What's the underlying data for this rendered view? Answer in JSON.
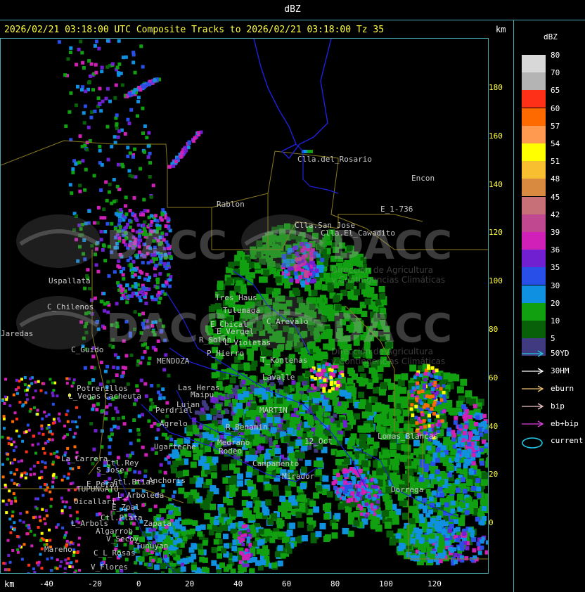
{
  "title": "dBZ",
  "header": "2026/02/21 03:18:00 UTC Composite Tracks to 2026/02/21 03:18:00 Tz 35",
  "units_top": "km",
  "units_bottom": "km",
  "y_ticks": [
    "180",
    "160",
    "140",
    "120",
    "100",
    "80",
    "60",
    "40",
    "20",
    "0"
  ],
  "x_ticks": [
    "-40",
    "-20",
    "0",
    "20",
    "40",
    "60",
    "80",
    "100",
    "120"
  ],
  "legend": {
    "title": "dBZ",
    "scale": [
      {
        "label": "80",
        "color": "#d8d8d8"
      },
      {
        "label": "70",
        "color": "#b4b4b4"
      },
      {
        "label": "65",
        "color": "#ff3018"
      },
      {
        "label": "60",
        "color": "#ff6a00"
      },
      {
        "label": "57",
        "color": "#ff9a50"
      },
      {
        "label": "54",
        "color": "#ffff00"
      },
      {
        "label": "51",
        "color": "#f8c030"
      },
      {
        "label": "48",
        "color": "#d88a40"
      },
      {
        "label": "45",
        "color": "#c87078"
      },
      {
        "label": "42",
        "color": "#c04890"
      },
      {
        "label": "39",
        "color": "#d020b8"
      },
      {
        "label": "36",
        "color": "#7020d0"
      },
      {
        "label": "35",
        "color": "#2850e8"
      },
      {
        "label": "30",
        "color": "#1090e0"
      },
      {
        "label": "20",
        "color": "#10a010"
      },
      {
        "label": "10",
        "color": "#086008"
      },
      {
        "label": "5",
        "color": "#403a80"
      }
    ],
    "tracks": [
      {
        "label": "50YD",
        "color": "#20c8d8"
      },
      {
        "label": "30HM",
        "color": "#ffffff"
      },
      {
        "label": "eburn",
        "color": "#e8c070"
      },
      {
        "label": "bip",
        "color": "#f0c8c8"
      },
      {
        "label": "eb+bip",
        "color": "#e040e0"
      }
    ],
    "current_label": "current",
    "current_color": "#20c8e8"
  },
  "watermark": {
    "name": "DACC",
    "tagline1": "Dirección de Agricultura",
    "tagline2": "y Contingencias Climáticas"
  },
  "places": [
    "Clla.del_Rosario",
    "Encon",
    "E_1-736",
    "Rablon",
    "Clla.San Jose",
    "Clla.El_Cawadito",
    "Uspallata",
    "C_Chilenos",
    "Jaredas",
    "C_Guido",
    "Potrerillos",
    "L_Vegas",
    "Cacheuta",
    "Perdriel",
    "Agrelo",
    "Ugarteche",
    "La_Carrera",
    "Ctl.Rey",
    "S_Jose",
    "Ctl.Btias",
    "Anchoris",
    "E_Peral",
    "TUPUNGATO",
    "L_Arboleda",
    "Oicallari",
    "E_Zpal",
    "Ctl.Plata",
    "Zapata",
    "L_Arbols",
    "Algarrob",
    "V_Secoy",
    "Tunuyan",
    "Mareno",
    "C_L_Rosas",
    "V_Flores",
    "Tres_Haus",
    "Tulumaga",
    "E_Chical",
    "E_Vergel",
    "L_Violetas",
    "C_Arevalo",
    "P_Hierro",
    "R_Solon",
    "T_Kontenas",
    "Lavalle",
    "MENDOZA",
    "Maipu",
    "R_Benamin",
    "MARTIN",
    "Medrano",
    "Rodeo",
    "Campamento",
    "12_Oct",
    "Mirador",
    "Lomas_Blancas",
    "Dorrega",
    "Las_Heras",
    "Lujan"
  ]
}
